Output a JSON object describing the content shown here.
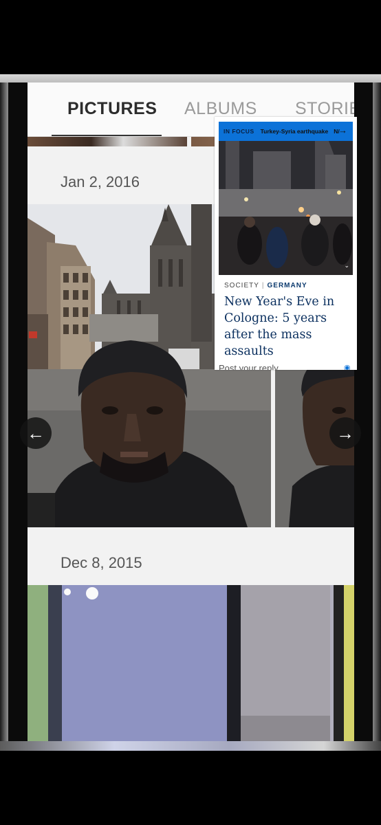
{
  "tabs": {
    "pictures": "PICTURES",
    "albums": "ALBUMS",
    "stories": "STORIES"
  },
  "groups": [
    {
      "date": "Jan 2, 2016"
    },
    {
      "date": "Dec 8, 2015"
    }
  ],
  "navigation": {
    "prev_icon": "arrow-left-icon",
    "next_icon": "arrow-right-icon"
  },
  "news_card": {
    "in_focus": "IN FOCUS",
    "topic": "Turkey-Syria earthquake",
    "more": "N/",
    "category": "SOCIETY",
    "separator": "|",
    "country": "GERMANY",
    "title": "New Year's Eve in Cologne: 5 years after the mass assaults",
    "reply_prompt": "Post your reply",
    "accent_color": "#0c72d8"
  }
}
